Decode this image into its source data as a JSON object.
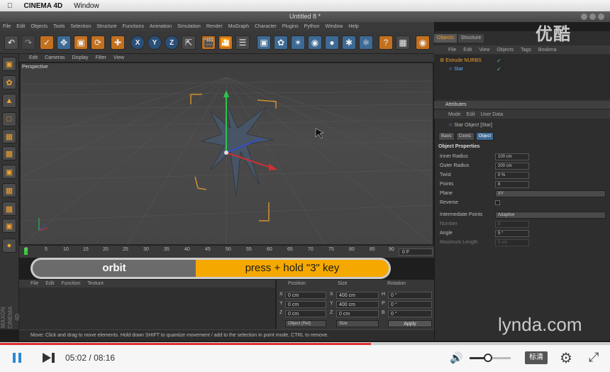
{
  "mac_menu": {
    "app": "CINEMA 4D",
    "items": [
      "Window"
    ]
  },
  "window_title": "Untitled 8 *",
  "main_menu": [
    "File",
    "Edit",
    "Objects",
    "Tools",
    "Selection",
    "Structure",
    "Functions",
    "Animation",
    "Simulation",
    "Render",
    "MoGraph",
    "Character",
    "Plugins",
    "Python",
    "Window",
    "Help"
  ],
  "axis_buttons": [
    "X",
    "Y",
    "Z"
  ],
  "viewport": {
    "menu": [
      "Edit",
      "Cameras",
      "Display",
      "Filter",
      "View"
    ],
    "label": "Perspective"
  },
  "timeline": {
    "ticks": [
      "0",
      "5",
      "10",
      "15",
      "20",
      "25",
      "30",
      "35",
      "40",
      "45",
      "50",
      "55",
      "60",
      "65",
      "70",
      "75",
      "80",
      "85",
      "90"
    ],
    "frame_field": "0 F",
    "current_frame": 0,
    "max_frame": 90
  },
  "banner": {
    "left": "orbit",
    "right": "press + hold \"3\" key"
  },
  "material_menu": [
    "File",
    "Edit",
    "Function",
    "Texture"
  ],
  "coordinates": {
    "headers": [
      "Position",
      "Size",
      "Rotation"
    ],
    "rows": [
      {
        "axis": "X",
        "pos": "0 cm",
        "size_axis": "X",
        "size": "400 cm",
        "rot_axis": "H",
        "rot": "0 °"
      },
      {
        "axis": "Y",
        "pos": "0 cm",
        "size_axis": "Y",
        "size": "400 cm",
        "rot_axis": "P",
        "rot": "0 °"
      },
      {
        "axis": "Z",
        "pos": "0 cm",
        "size_axis": "Z",
        "size": "0 cm",
        "rot_axis": "B",
        "rot": "0 °"
      }
    ],
    "mode_dropdown": "Object (Rel)",
    "size_dropdown": "Size",
    "apply_label": "Apply"
  },
  "status_text": "Move: Click and drag to move elements. Hold down SHIFT to quantize movement / add to the selection in point mode, CTRL to remove.",
  "maxon_logo": "MAXON CINEMA 4D",
  "object_manager": {
    "tabs": [
      "Objects",
      "Structure"
    ],
    "menu": [
      "File",
      "Edit",
      "View",
      "Objects",
      "Tags",
      "Bookma"
    ],
    "objects": [
      {
        "name": "Extrude NURBS",
        "color": "#f0a030"
      },
      {
        "name": "Star",
        "color": "#6ab0ff"
      }
    ]
  },
  "attributes": {
    "header": "Attributes",
    "menu": [
      "Mode",
      "Edit",
      "User Data"
    ],
    "object_title": "Star Object [Star]",
    "tabs": [
      "Basic",
      "Coord.",
      "Object"
    ],
    "section_title": "Object Properties",
    "props": [
      {
        "label": "Inner Radius",
        "value": "100 cm",
        "type": "num"
      },
      {
        "label": "Outer Radius",
        "value": "200 cm",
        "type": "num"
      },
      {
        "label": "Twist",
        "value": "0 %",
        "type": "num"
      },
      {
        "label": "Points",
        "value": "8",
        "type": "num"
      },
      {
        "label": "Plane",
        "value": "XY",
        "type": "select"
      },
      {
        "label": "Reverse",
        "value": "",
        "type": "check"
      },
      {
        "label": "Intermediate Points",
        "value": "Adaptive",
        "type": "select"
      },
      {
        "label": "Number",
        "value": "8",
        "type": "num_dim"
      },
      {
        "label": "Angle",
        "value": "5 °",
        "type": "num"
      },
      {
        "label": "Maximum Length",
        "value": "5 cm",
        "type": "num_dim"
      }
    ]
  },
  "watermark": "优酷",
  "lynda_logo": "lynda.com",
  "player": {
    "current_time": "05:02",
    "separator": "/",
    "total_time": "08:16",
    "progress_fraction": 0.608,
    "volume_fraction": 0.45,
    "quality_label": "标清"
  },
  "colors": {
    "accent_orange": "#f5a800",
    "progress": "#e03030",
    "play_blue": "#2a8ad4"
  }
}
